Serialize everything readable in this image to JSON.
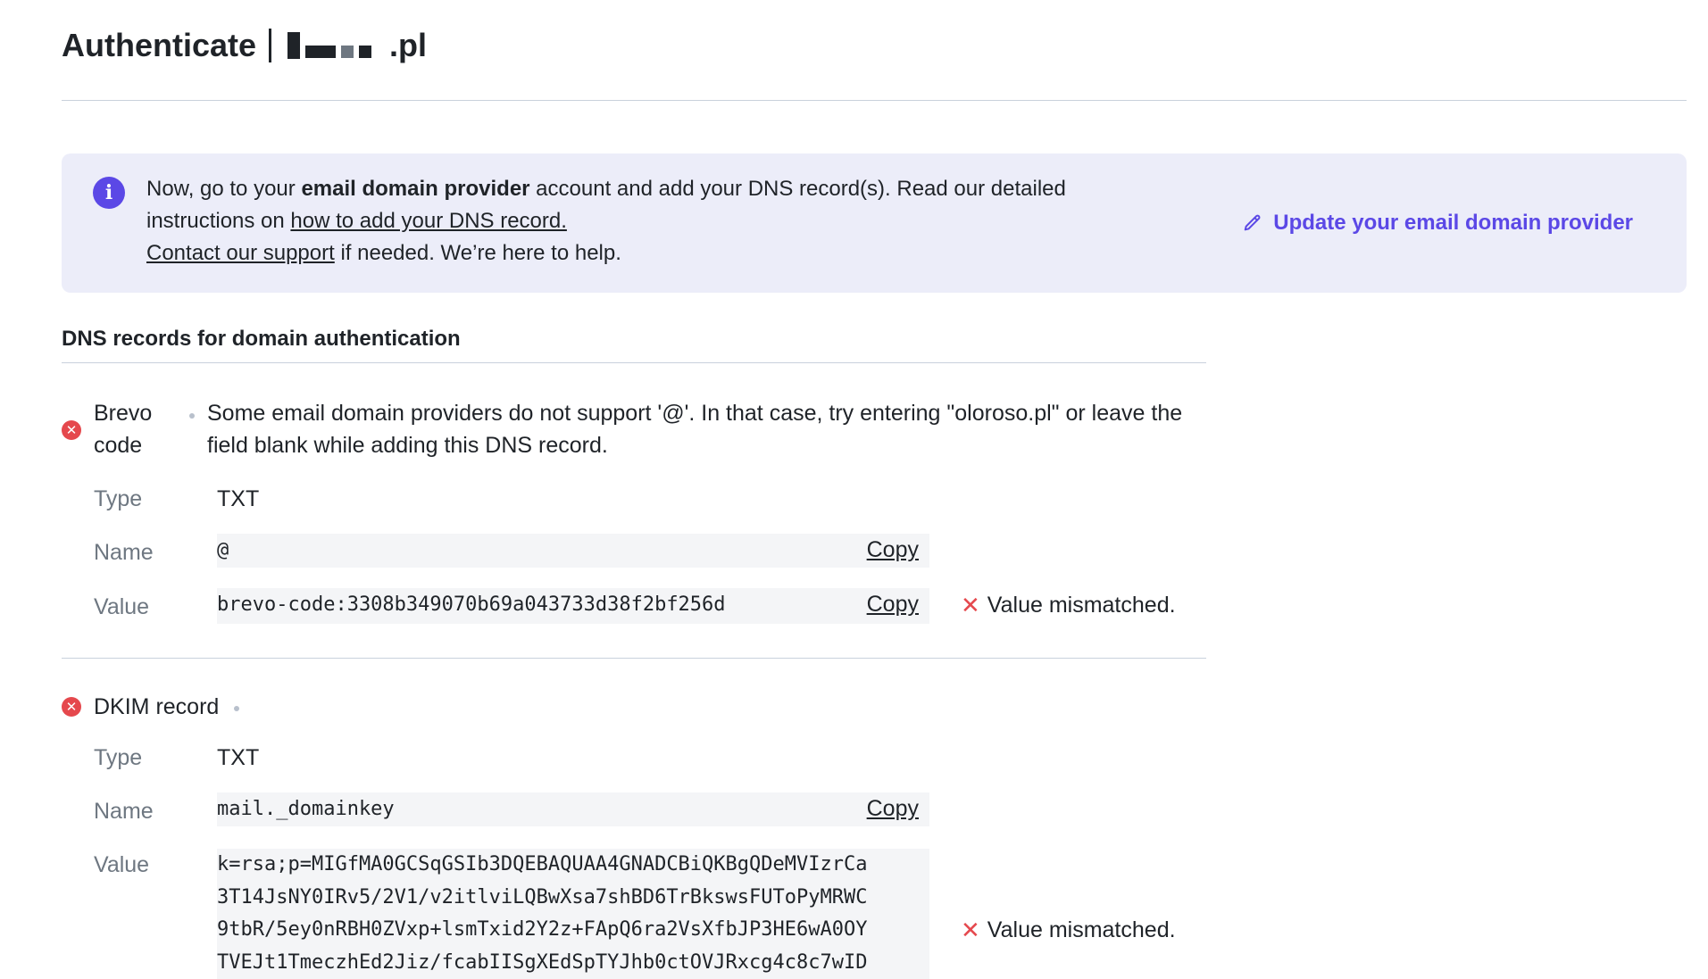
{
  "header": {
    "title": "Authenticate",
    "domain_suffix": ".pl"
  },
  "banner": {
    "icon": "info-icon",
    "text_part1": "Now, go to your ",
    "text_bold": "email domain provider",
    "text_part2": " account and add your DNS record(s). Read our detailed instructions on ",
    "instructions_link": "how to add your DNS record.",
    "support_link": "Contact our support",
    "text_part3": " if needed. We’re here to help.",
    "update_link": "Update your email domain provider",
    "accent": "#5b48e6",
    "background": "#ecedf9"
  },
  "section": {
    "title": "DNS records for domain authentication"
  },
  "records": [
    {
      "label": "Brevo code",
      "status_icon": "error-icon",
      "note": "Some email domain providers do not support '@'. In that case, try entering \"oloroso.pl\" or leave the field blank while adding this DNS record.",
      "type_label": "Type",
      "type": "TXT",
      "name_label": "Name",
      "name": "@",
      "value_label": "Value",
      "value": "brevo-code:3308b349070b69a043733d38f2bf256d",
      "copy_label": "Copy",
      "status": "Value mismatched."
    },
    {
      "label": "DKIM record",
      "status_icon": "error-icon",
      "type_label": "Type",
      "type": "TXT",
      "name_label": "Name",
      "name": "mail._domainkey",
      "value_label": "Value",
      "value_lines": [
        "k=rsa;p=MIGfMA0GCSqGSIb3DQEBAQUAA4GNADCBiQKBgQDeMVIzrCa",
        "3T14JsNY0IRv5/2V1/v2itlviLQBwXsa7shBD6TrBkswsFUToPyMRWC",
        "9tbR/5ey0nRBH0ZVxp+lsmTxid2Y2z+FApQ6ra2VsXfbJP3HE6wA0OY",
        "TVEJt1TmeczhEd2Jiz/fcabIISgXEdSpTYJhb0ctOVJRxcg4c8c7wID"
      ],
      "copy_label": "Copy",
      "status": "Value mismatched."
    }
  ],
  "colors": {
    "error": "#e5484d",
    "muted": "#6e7781",
    "code_background": "#f4f5f7"
  }
}
